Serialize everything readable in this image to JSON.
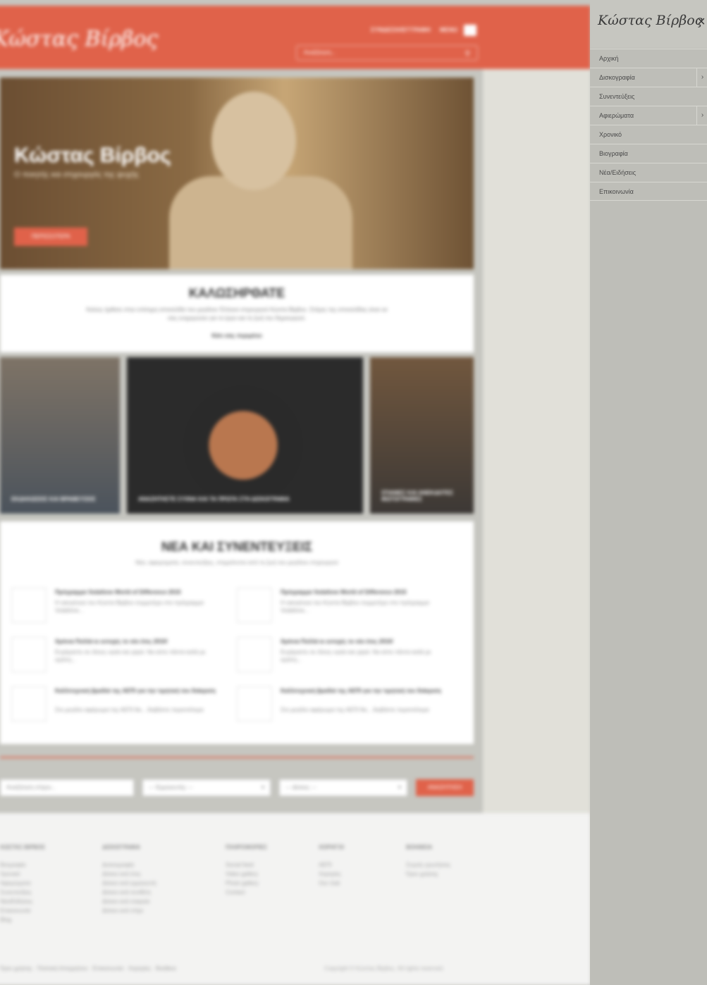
{
  "site": {
    "logo_text": "Κώστας Βίρβος",
    "top_links": [
      "ΣΥΝΔΕΣΗ/ΕΓΓΡΑΦΗ",
      "MENU"
    ],
    "search_placeholder": "Αναζήτηση..."
  },
  "hero": {
    "title": "Κώστας Βίρβος",
    "subtitle": "Ο ποιητής και στιχουργός της ψυχής",
    "button": "ΠΕΡΙΣΣΟΤΕΡΑ"
  },
  "welcome": {
    "heading": "ΚΑΛΩΣΗΡΘΑΤΕ",
    "text": "Καλώς ήρθατε στην επίσημη ιστοσελίδα του μεγάλου Έλληνα στιχουργού Κώστα Βίρβου. Στόχος της ιστοσελίδας είναι να σας ενημερώσει για το έργο και τη ζωή του δημιουργού.",
    "link": "Κάτι σας περιμένει"
  },
  "tiles": [
    "ΕΚΔΗΛΩΣΕΙΣ ΚΑΙ ΒΡΑΒΕΥΣΕΙΣ",
    "ΑΝΑΖΗΤΗΣΤΕ ΣΥΧΝΑ ΚΑΙ ΤΑ ΠΡΩΤΑ ΣΤΗ ΔΙΣΚΟΓΡΑΦΙΑ",
    "ΣΠΑΝΙΕΣ ΚΑΙ ΑΝΕΚΔΟΤΕΣ ΦΩΤΟΓΡΑΦΙΕΣ"
  ],
  "news": {
    "heading": "ΝΕΑ ΚΑΙ ΣΥΝΕΝΤΕΥΞΕΙΣ",
    "subtitle": "Νέα, αφιερώματα, συνεντεύξεις, στιγμιότυπα από τη ζωή του μεγάλου στιχουργού",
    "items": [
      {
        "title": "Πρόγραμμα Vodafone World of Difference 2015",
        "snippet": "Η οικογένεια του Κώστα Βίρβου συμμετέχει στο πρόγραμμα Vodafone..."
      },
      {
        "title": "Πρόγραμμα Vodafone World of Difference 2015",
        "snippet": "Η οικογένεια του Κώστα Βίρβου συμμετέχει στο πρόγραμμα Vodafone..."
      },
      {
        "title": "Χρόνια Πολλά κι ευτυχές το νέο έτος 2016!",
        "snippet": "Ευχόμαστε σε όλους υγεία και χαρά. Να είστε πάντα καλά με αγάπη..."
      },
      {
        "title": "Χρόνια Πολλά κι ευτυχές το νέο έτος 2016!",
        "snippet": "Ευχόμαστε σε όλους υγεία και χαρά. Να είστε πάντα καλά με αγάπη..."
      },
      {
        "title": "Καλλιτεχνική βραδιά της ΑΕΠΙ για την τιμητική του διάκριση",
        "snippet": "Στο μεγάλο αφιέρωμα της ΑΕΠΙ θα... διαβάστε περισσότερα"
      },
      {
        "title": "Καλλιτεχνική βραδιά της ΑΕΠΙ για την τιμητική του διάκριση",
        "snippet": "Στο μεγάλο αφιέρωμα της ΑΕΠΙ θα... διαβάστε περισσότερα"
      }
    ]
  },
  "filters": {
    "input_placeholder": "Αναζήτηση στίχου...",
    "select1": "--- Ερμηνευτής ---",
    "select2": "--- Δίσκος ---",
    "button": "ΑΝΑΖΗΤΗΣΗ"
  },
  "footer": {
    "columns": [
      {
        "heading": "ΚΩΣΤΑΣ ΒΙΡΒΟΣ",
        "links": [
          "Βιογραφία",
          "Χρονικό",
          "Αφιερώματα",
          "Συνεντεύξεις",
          "Νέα/Ειδήσεις",
          "Επικοινωνία",
          "Blog"
        ]
      },
      {
        "heading": "ΔΙΣΚΟΓΡΑΦΙΑ",
        "links": [
          "Δισκογραφία",
          "Δίσκοι ανά έτος",
          "Δίσκοι ανά ερμηνευτή",
          "Δίσκοι ανά συνθέτη",
          "Δίσκοι ανά εταιρεία",
          "Δίσκοι ανά στίχο"
        ]
      },
      {
        "heading": "ΠΛΗΡΟΦΟΡΙΕΣ",
        "links": [
          "Social feed",
          "Video gallery",
          "Photo gallery",
          "Contact"
        ]
      },
      {
        "heading": "ΧΟΡΗΓΟΙ",
        "links": [
          "ΑΕΠΙ",
          "Χορηγίες",
          "Our club"
        ]
      },
      {
        "heading": "ΒΟΗΘΕΙΑ",
        "links": [
          "Συχνές ερωτήσεις",
          "Όροι χρήσης"
        ]
      }
    ],
    "bottom_links": "Όροι χρήσης · Πολιτική Απορρήτου · Επικοινωνία · Χορηγίες · Βοήθεια",
    "copyright": "Copyright © Κώστας Βίρβος. All rights reserved."
  },
  "sidemenu": {
    "logo_text": "Κώστας Βίρβος",
    "close_glyph": "×",
    "items": [
      {
        "label": "Αρχική",
        "has_sub": false
      },
      {
        "label": "Δισκογραφία",
        "has_sub": true
      },
      {
        "label": "Συνεντεύξεις",
        "has_sub": false
      },
      {
        "label": "Αφιερώματα",
        "has_sub": true
      },
      {
        "label": "Χρονικό",
        "has_sub": false
      },
      {
        "label": "Βιογραφία",
        "has_sub": false
      },
      {
        "label": "Νέα/Ειδήσεις",
        "has_sub": false
      },
      {
        "label": "Επικοινωνία",
        "has_sub": false
      }
    ],
    "sub_glyph": "›"
  },
  "colors": {
    "accent": "#e0624a",
    "side_bg": "#bebeb8"
  }
}
